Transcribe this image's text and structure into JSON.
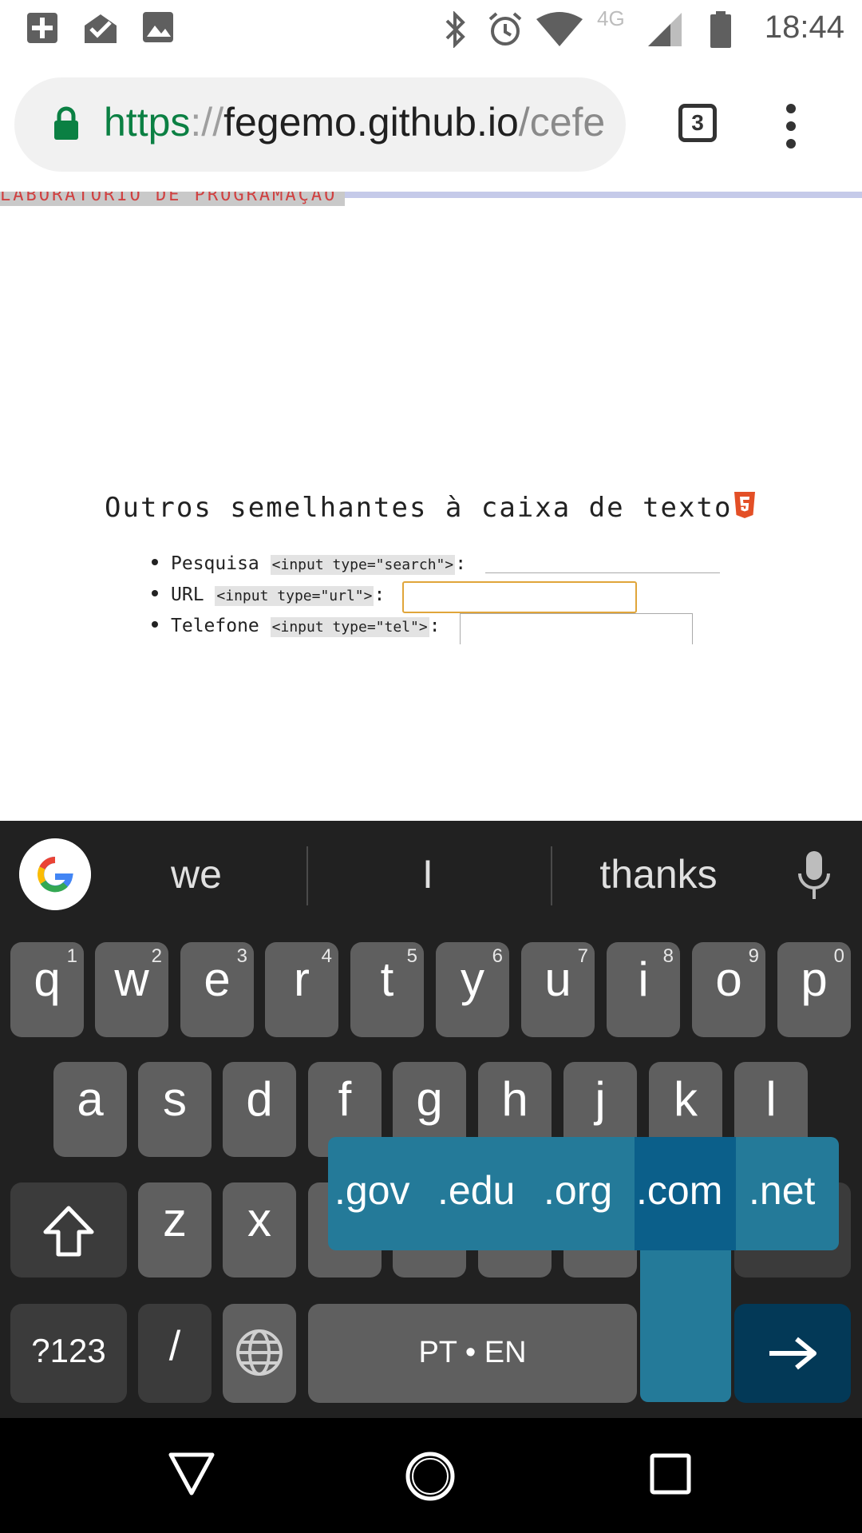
{
  "status_bar": {
    "time": "18:44",
    "network": "4G",
    "icons": [
      "add-box-icon",
      "mail-icon",
      "image-icon",
      "bluetooth-icon",
      "alarm-icon",
      "wifi-icon",
      "signal-icon",
      "battery-icon"
    ]
  },
  "browser": {
    "url_scheme": "https",
    "url_sep": "://",
    "url_host": "fegemo.github.io",
    "url_path": "/cefe",
    "tab_count": "3"
  },
  "page": {
    "header_peek": "LABORATÓRIO DE PROGRAMAÇÃO WEB",
    "section_title": "Outros semelhantes à caixa de texto",
    "items": [
      {
        "label": "Pesquisa",
        "code": "<input type=\"search\">",
        "suffix": ":"
      },
      {
        "label": "URL",
        "code": "<input type=\"url\">",
        "suffix": ":"
      },
      {
        "label": "Telefone",
        "code": "<input type=\"tel\">",
        "suffix": ":"
      }
    ],
    "url_input_value": "",
    "focused_field": "url"
  },
  "keyboard": {
    "suggestions": [
      "we",
      "I",
      "thanks"
    ],
    "row1": [
      {
        "char": "q",
        "hint": "1"
      },
      {
        "char": "w",
        "hint": "2"
      },
      {
        "char": "e",
        "hint": "3"
      },
      {
        "char": "r",
        "hint": "4"
      },
      {
        "char": "t",
        "hint": "5"
      },
      {
        "char": "y",
        "hint": "6"
      },
      {
        "char": "u",
        "hint": "7"
      },
      {
        "char": "i",
        "hint": "8"
      },
      {
        "char": "o",
        "hint": "9"
      },
      {
        "char": "p",
        "hint": "0"
      }
    ],
    "row2": [
      "a",
      "s",
      "d",
      "f",
      "g",
      "h",
      "j",
      "k",
      "l"
    ],
    "row3": [
      "z",
      "x"
    ],
    "symbols_label": "?123",
    "slash_label": "/",
    "space_label": "PT • EN",
    "domain_popup": [
      ".gov",
      ".edu",
      ".org",
      ".com",
      ".net"
    ],
    "domain_selected": ".com"
  },
  "colors": {
    "scheme_green": "#0b8043",
    "keyboard_bg": "#212121",
    "key_bg": "#5f5f5f",
    "popup_bg": "#247a99",
    "popup_selected": "#0b5f8a",
    "enter_bg": "#033957",
    "focus_border": "#e0a53a",
    "html5_orange": "#e34f26"
  }
}
